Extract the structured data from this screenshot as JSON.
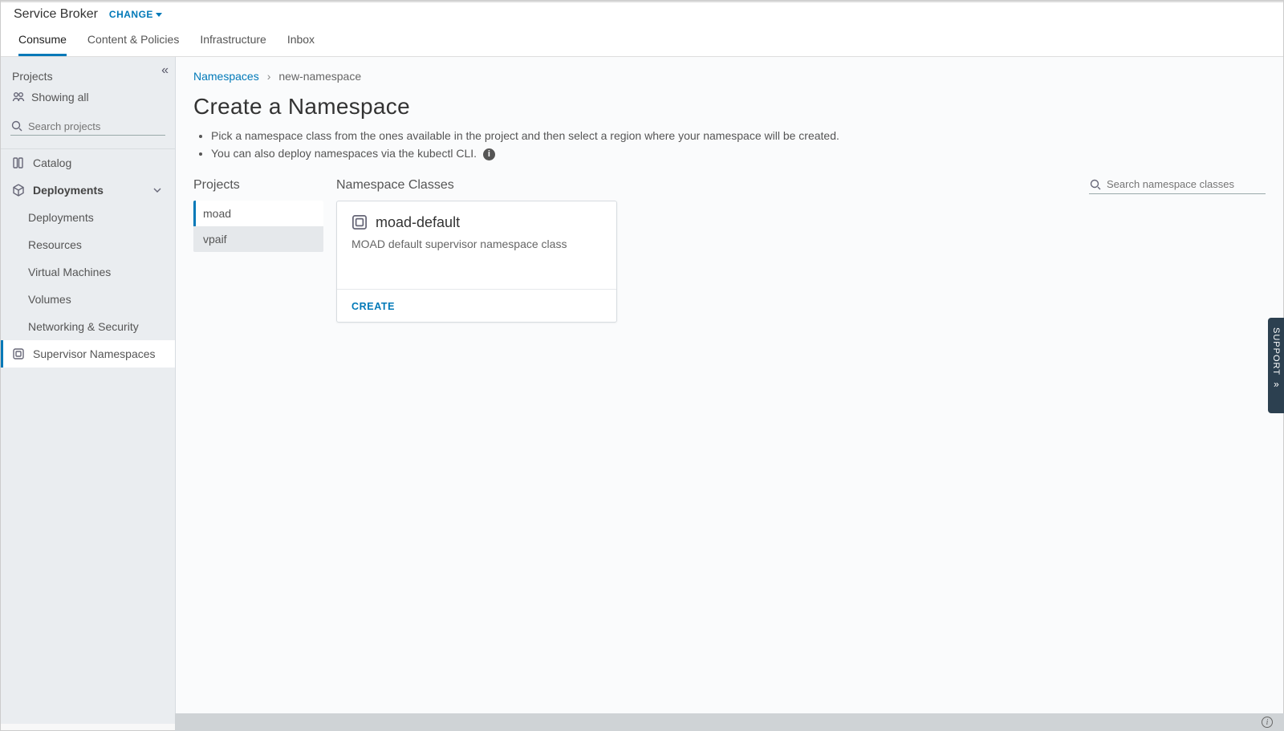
{
  "header": {
    "app_title": "Service Broker",
    "change_label": "CHANGE"
  },
  "tabs": [
    {
      "label": "Consume",
      "active": true
    },
    {
      "label": "Content & Policies",
      "active": false
    },
    {
      "label": "Infrastructure",
      "active": false
    },
    {
      "label": "Inbox",
      "active": false
    }
  ],
  "sidebar": {
    "projects_header": "Projects",
    "showing_label": "Showing all",
    "search_placeholder": "Search projects",
    "nav": {
      "catalog": "Catalog",
      "deployments": "Deployments",
      "deployments_sub": [
        "Deployments",
        "Resources",
        "Virtual Machines",
        "Volumes",
        "Networking & Security"
      ],
      "supervisor": "Supervisor Namespaces"
    }
  },
  "breadcrumb": {
    "root": "Namespaces",
    "current": "new-namespace"
  },
  "page": {
    "title": "Create a Namespace",
    "help1": "Pick a namespace class from the ones available in the project and then select a region where your namespace will be created.",
    "help2": "You can also deploy namespaces via the kubectl CLI."
  },
  "columns": {
    "projects_label": "Projects",
    "classes_label": "Namespace Classes",
    "search_classes_placeholder": "Search namespace classes"
  },
  "projects": [
    {
      "name": "moad",
      "selected": true
    },
    {
      "name": "vpaif",
      "selected": false
    }
  ],
  "classes": [
    {
      "title": "moad-default",
      "desc": "MOAD default supervisor namespace class",
      "create_label": "CREATE"
    }
  ],
  "support_label": "SUPPORT"
}
